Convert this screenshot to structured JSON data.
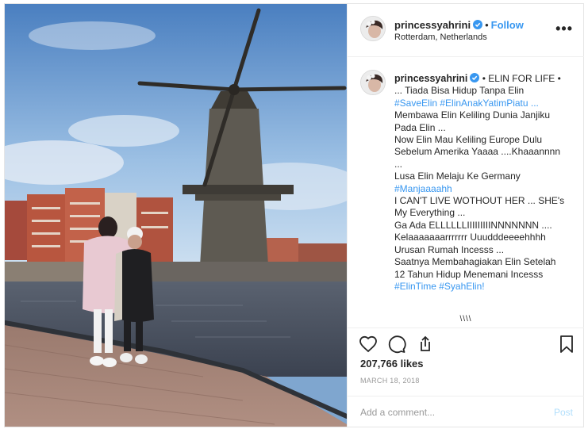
{
  "post": {
    "username": "princessyahrini",
    "follow_label": "Follow",
    "location": "Rotterdam, Netherlands",
    "more_icon": "more-options-icon"
  },
  "caption": {
    "username": "princessyahrini",
    "lines": [
      {
        "text": "• ELIN FOR LIFE •",
        "type": "plain"
      },
      {
        "text": "... Tiada Bisa Hidup Tanpa Elin",
        "type": "plain"
      },
      {
        "text": "#SaveElin #ElinAnakYatimPiatu ...",
        "type": "tag"
      },
      {
        "text": "Membawa Elin Keliling Dunia Janjiku",
        "type": "plain"
      },
      {
        "text": "Pada Elin ...",
        "type": "plain"
      },
      {
        "text": "Now Elin Mau Keliling Europe Dulu",
        "type": "plain"
      },
      {
        "text": "Sebelum Amerika Yaaaa ....Khaaannnn",
        "type": "plain"
      },
      {
        "text": "...",
        "type": "plain"
      },
      {
        "text": "Lusa Elin Melaju Ke Germany",
        "type": "plain"
      },
      {
        "text": "#Manjaaaahh",
        "type": "tag"
      },
      {
        "text": "I CAN'T LIVE WOTHOUT HER ... SHE's",
        "type": "plain"
      },
      {
        "text": "My Everything ...",
        "type": "plain"
      },
      {
        "text": "Ga Ada ELLLLLLIIIIIIIIINNNNNNN ....",
        "type": "plain"
      },
      {
        "text": "Kelaaaaaaarrrrrrr Uuudddeeeehhhh",
        "type": "plain"
      },
      {
        "text": "Urusan Rumah Incesss ...",
        "type": "plain"
      },
      {
        "text": "Saatnya Membahagiakan Elin Setelah",
        "type": "plain"
      },
      {
        "text": "12 Tahun Hidup Menemani Incesss",
        "type": "plain"
      },
      {
        "text": "#ElinTime #SyahElin!",
        "type": "tag"
      }
    ],
    "load_more": "\\\\\\\\"
  },
  "actions": {
    "like_icon": "heart-icon",
    "comment_icon": "comment-icon",
    "share_icon": "share-icon",
    "save_icon": "bookmark-icon"
  },
  "likes": "207,766 likes",
  "date": "MARCH 18, 2018",
  "comment_box": {
    "placeholder": "Add a comment...",
    "post_label": "Post"
  },
  "colors": {
    "link": "#3897f0",
    "hashtag": "#003569",
    "verified": "#3897f0",
    "post_disabled": "#b2dffc"
  }
}
